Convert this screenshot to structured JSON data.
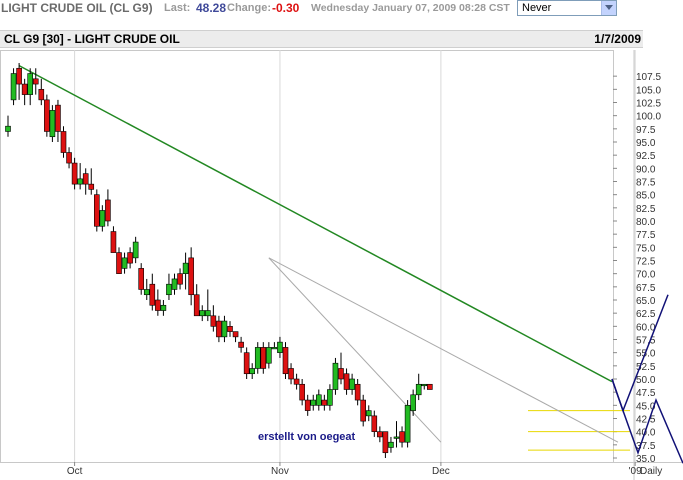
{
  "topbar": {
    "title": "LIGHT CRUDE OIL (CL G9)",
    "last_label": "Last:",
    "last_value": "48.28",
    "change_label": "Change:",
    "change_value": "-0.30",
    "datetime": "Wednesday January 07, 2009 08:28 CST",
    "refresh_select": "Never"
  },
  "header": {
    "title": "CL G9 [30] - LIGHT CRUDE OIL",
    "date": "1/7/2009"
  },
  "annotation": "erstellt von oegeat",
  "colors": {
    "up": "#22bb22",
    "down": "#dd1111",
    "trend": "#228822",
    "fib": "#e8d800",
    "projection": "#111177"
  },
  "chart_data": {
    "type": "candlestick",
    "y_range": [
      35.0,
      110.0
    ],
    "y_ticks": [
      "107.5",
      "105.0",
      "102.5",
      "100.0",
      "97.5",
      "95.0",
      "92.5",
      "90.0",
      "87.5",
      "85.0",
      "82.5",
      "80.0",
      "77.5",
      "75.0",
      "72.5",
      "70.0",
      "67.5",
      "65.0",
      "62.5",
      "60.0",
      "57.5",
      "55.0",
      "52.5",
      "50.0",
      "47.5",
      "45.0",
      "42.5",
      "40.0",
      "37.5",
      "35.0"
    ],
    "x_labels": [
      {
        "label": "Oct",
        "index": 12
      },
      {
        "label": "Nov",
        "index": 49
      },
      {
        "label": "Dec",
        "index": 78
      },
      {
        "label": "'09",
        "index": 113
      }
    ],
    "period_label": "Daily",
    "candles": [
      [
        97,
        98,
        100,
        96
      ],
      [
        103,
        108,
        109,
        102
      ],
      [
        109,
        106,
        110,
        103
      ],
      [
        106,
        104,
        107,
        102
      ],
      [
        104,
        108,
        109,
        102
      ],
      [
        107,
        106,
        109,
        104
      ],
      [
        105,
        103,
        107,
        102
      ],
      [
        103,
        97,
        104,
        96
      ],
      [
        96,
        101,
        102,
        95
      ],
      [
        102,
        97,
        103,
        95
      ],
      [
        97,
        93,
        98,
        92
      ],
      [
        93,
        91,
        94,
        90
      ],
      [
        91,
        87,
        92,
        86
      ],
      [
        87,
        88,
        91,
        86
      ],
      [
        89,
        87,
        90,
        85
      ],
      [
        87,
        86,
        90,
        85
      ],
      [
        85,
        79,
        86,
        78
      ],
      [
        79,
        82,
        83,
        78
      ],
      [
        84,
        80,
        86,
        79
      ],
      [
        78,
        74,
        79,
        74
      ],
      [
        74,
        70,
        75,
        70
      ],
      [
        71,
        73,
        74,
        70
      ],
      [
        74,
        72,
        75,
        71
      ],
      [
        73,
        76,
        77,
        72
      ],
      [
        71,
        67,
        72,
        66
      ],
      [
        66,
        67,
        69,
        65
      ],
      [
        68,
        64,
        70,
        63
      ],
      [
        65,
        63,
        67,
        62
      ],
      [
        63,
        64,
        65,
        62
      ],
      [
        66,
        68,
        70,
        65
      ],
      [
        67,
        69,
        70,
        66
      ],
      [
        70,
        68,
        71,
        67
      ],
      [
        70,
        72,
        74,
        67
      ],
      [
        73,
        66,
        75,
        64
      ],
      [
        66,
        62,
        68,
        62
      ],
      [
        62,
        63,
        64,
        61
      ],
      [
        62,
        63,
        67,
        61
      ],
      [
        62,
        60,
        64,
        59
      ],
      [
        61,
        58,
        62,
        57
      ],
      [
        58,
        61,
        62,
        57
      ],
      [
        60,
        59,
        61,
        58
      ],
      [
        59,
        58,
        59,
        57
      ],
      [
        57,
        56,
        58,
        55
      ],
      [
        55,
        51,
        56,
        50
      ],
      [
        51,
        52,
        53,
        50
      ],
      [
        52,
        56,
        57,
        51
      ],
      [
        56,
        52,
        57,
        51
      ],
      [
        53,
        56,
        57,
        52
      ],
      [
        56,
        56,
        57,
        56
      ],
      [
        55,
        57,
        58,
        54
      ],
      [
        56,
        51,
        57,
        50
      ],
      [
        52,
        50,
        53,
        49
      ],
      [
        50,
        49,
        51,
        48
      ],
      [
        49,
        46,
        50,
        45
      ],
      [
        46,
        44,
        47,
        43
      ],
      [
        45,
        46,
        47,
        44
      ],
      [
        45,
        47,
        48,
        44
      ],
      [
        46,
        45,
        47,
        44
      ],
      [
        45,
        48,
        49,
        44
      ],
      [
        48,
        53,
        54,
        47
      ],
      [
        52,
        50,
        55,
        49
      ],
      [
        51,
        48,
        52,
        47
      ],
      [
        48,
        50,
        51,
        47
      ],
      [
        49,
        46,
        50,
        45
      ],
      [
        46,
        42,
        47,
        41
      ],
      [
        43,
        44,
        45,
        42
      ],
      [
        43,
        40,
        44,
        39
      ],
      [
        40,
        39,
        41,
        38
      ],
      [
        40,
        36,
        40,
        35
      ],
      [
        37,
        38,
        39,
        36
      ],
      [
        39,
        39,
        42,
        37
      ],
      [
        40,
        38,
        41,
        37
      ],
      [
        38,
        45,
        46,
        37
      ],
      [
        44,
        47,
        48,
        43
      ],
      [
        47,
        49,
        51,
        46
      ],
      [
        49,
        49,
        49,
        48
      ],
      [
        49,
        48,
        49,
        48
      ]
    ],
    "projection_label": "blue zigzag projection lines"
  }
}
